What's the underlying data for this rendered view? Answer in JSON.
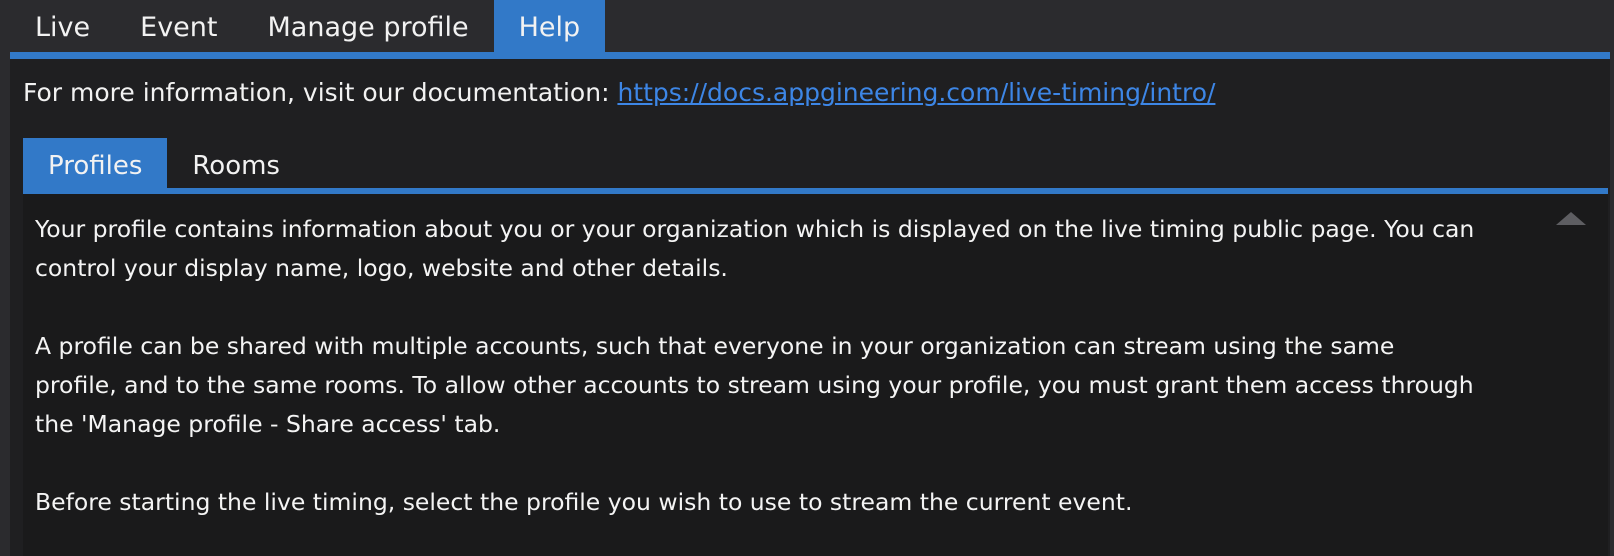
{
  "top_tabs": [
    {
      "label": "Live"
    },
    {
      "label": "Event"
    },
    {
      "label": "Manage profile"
    },
    {
      "label": "Help"
    }
  ],
  "active_top_tab": "Help",
  "info": {
    "prefix": "For more information, visit our documentation: ",
    "link_text": "https://docs.appgineering.com/live-timing/intro/",
    "link_href": "https://docs.appgineering.com/live-timing/intro/"
  },
  "sub_tabs": [
    {
      "label": "Profiles"
    },
    {
      "label": "Rooms"
    }
  ],
  "active_sub_tab": "Profiles",
  "content": {
    "paragraphs": [
      "Your profile contains information about you or your organization which is displayed on the live timing public page. You can control your display name, logo, website and other details.",
      "A profile can be shared with multiple accounts, such that everyone in your organization can stream using the same profile, and to the same rooms. To allow other accounts to stream using your profile, you must grant them access through the 'Manage profile - Share access' tab.",
      "Before starting the live timing, select the profile you wish to use to stream the current event."
    ]
  },
  "colors": {
    "accent": "#3279c8",
    "link": "#3d86e6",
    "background": "#2b2b2e",
    "panel": "#1f1f21"
  },
  "icons": {
    "scroll_up": "triangle-up-icon"
  }
}
